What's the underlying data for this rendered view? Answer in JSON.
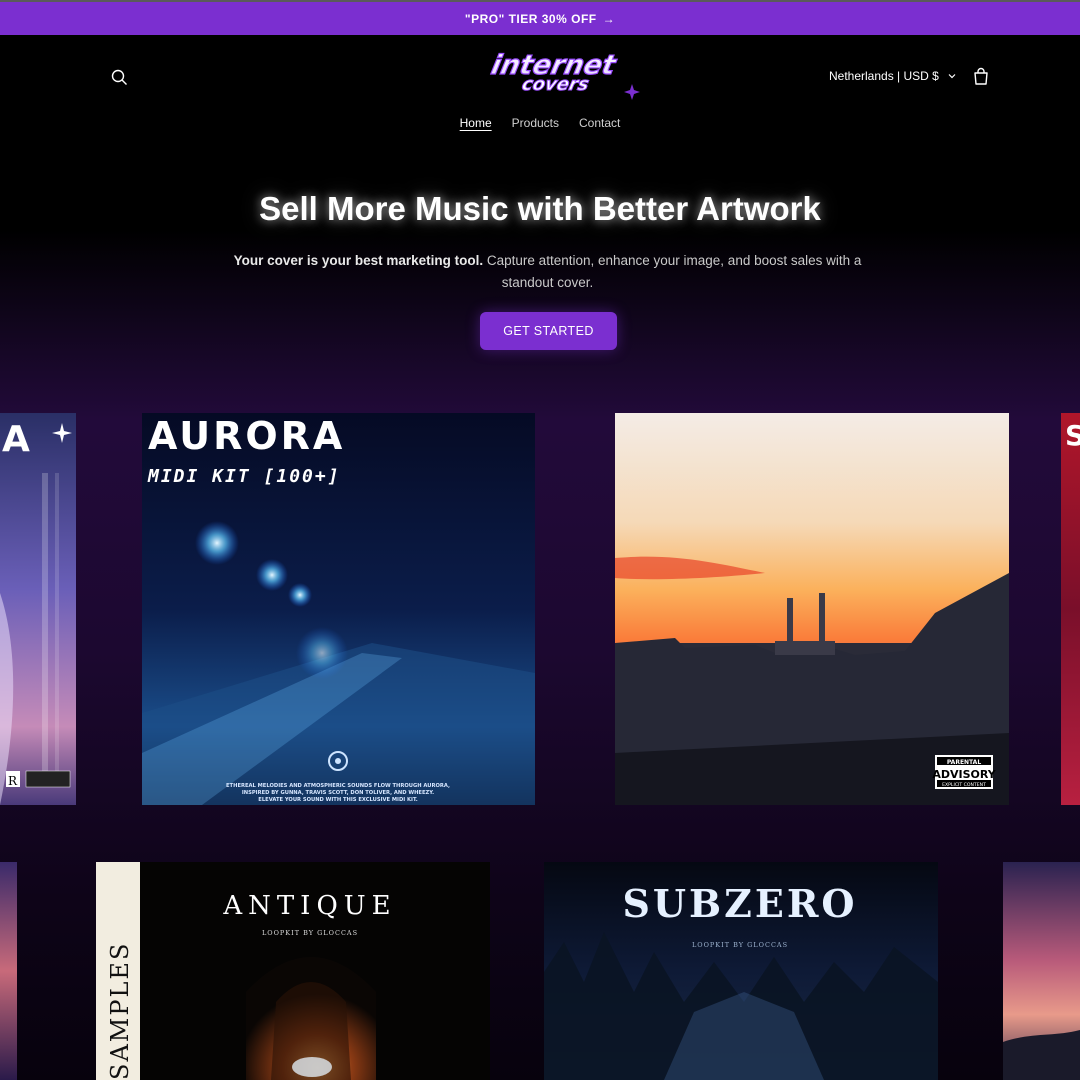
{
  "announcement": {
    "text": "\"PRO\" TIER 30% OFF",
    "arrow": "→"
  },
  "header": {
    "logo_text": "internet covers",
    "locale": "Netherlands | USD $",
    "icons": {
      "search": "search-icon",
      "cart": "cart-icon",
      "locale_chevron": "chevron-down-icon"
    }
  },
  "nav": [
    {
      "label": "Home",
      "active": true
    },
    {
      "label": "Products",
      "active": false
    },
    {
      "label": "Contact",
      "active": false
    }
  ],
  "hero": {
    "title": "Sell More Music with Better Artwork",
    "subtitle_bold": "Your cover is your best marketing tool.",
    "subtitle_rest": " Capture attention, enhance your image, and boost sales with a standout cover.",
    "cta": "GET STARTED"
  },
  "covers": {
    "aurora": {
      "title": "AURORA",
      "subtitle": "MIDI KIT [100+]",
      "caption_line1": "ETHEREAL MELODIES AND ATMOSPHERIC SOUNDS FLOW THROUGH AURORA,",
      "caption_line2": "INSPIRED BY GUNNA, TRAVIS SCOTT, DON TOLIVER, AND WHEEZY.",
      "caption_line3": "ELEVATE YOUR SOUND WITH THIS EXCLUSIVE MIDI KIT."
    },
    "sunset": {
      "advisory_top": "PARENTAL",
      "advisory_mid": "ADVISORY",
      "advisory_bottom": "EXPLICIT CONTENT"
    },
    "antique": {
      "title": "ANTIQUE",
      "subtitle": "LOOPKIT BY GLOCCAS",
      "spine": "SAMPLES"
    },
    "subzero": {
      "title": "SUBZERO",
      "subtitle": "LOOPKIT BY GLOCCAS"
    },
    "left_partial": {
      "letter": "A",
      "badge": "R"
    },
    "right_partial": {
      "letter": "S"
    }
  },
  "colors": {
    "accent": "#7b2fd0",
    "background": "#000000"
  }
}
